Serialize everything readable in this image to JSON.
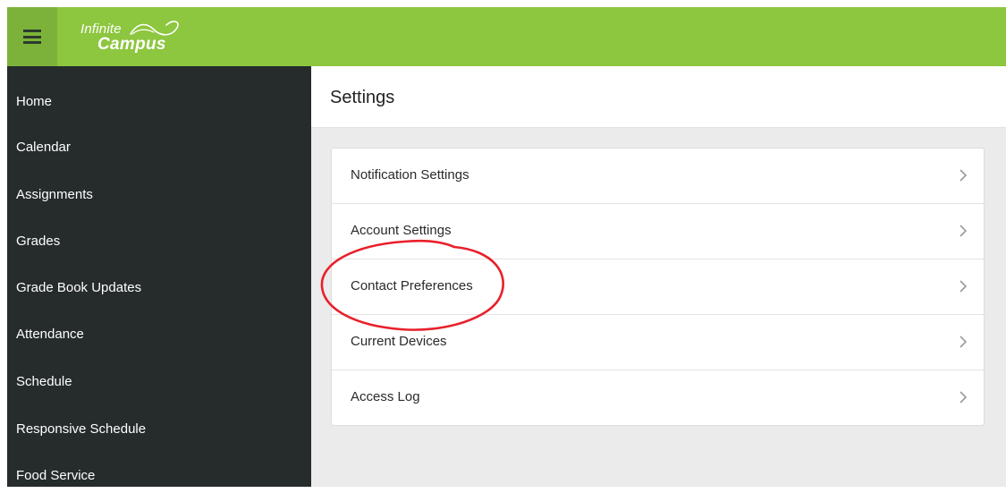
{
  "header": {
    "brand_line1": "Infinite",
    "brand_line2": "Campus",
    "menu_icon": "hamburger-menu-icon",
    "brand_color": "#8dc63f"
  },
  "sidebar": {
    "background": "#262b2b",
    "items": [
      {
        "label": "Home"
      },
      {
        "label": "Calendar"
      },
      {
        "label": "Assignments"
      },
      {
        "label": "Grades"
      },
      {
        "label": "Grade Book Updates"
      },
      {
        "label": "Attendance"
      },
      {
        "label": "Schedule"
      },
      {
        "label": "Responsive Schedule"
      },
      {
        "label": "Food Service"
      }
    ]
  },
  "main": {
    "title": "Settings",
    "settings": [
      {
        "label": "Notification Settings",
        "icon": "chevron-right-icon"
      },
      {
        "label": "Account Settings",
        "icon": "chevron-right-icon"
      },
      {
        "label": "Contact Preferences",
        "icon": "chevron-right-icon",
        "highlighted": true
      },
      {
        "label": "Current Devices",
        "icon": "chevron-right-icon"
      },
      {
        "label": "Access Log",
        "icon": "chevron-right-icon"
      }
    ]
  },
  "annotation": {
    "type": "red-circle",
    "color": "#e8202a",
    "target": "Contact Preferences"
  }
}
